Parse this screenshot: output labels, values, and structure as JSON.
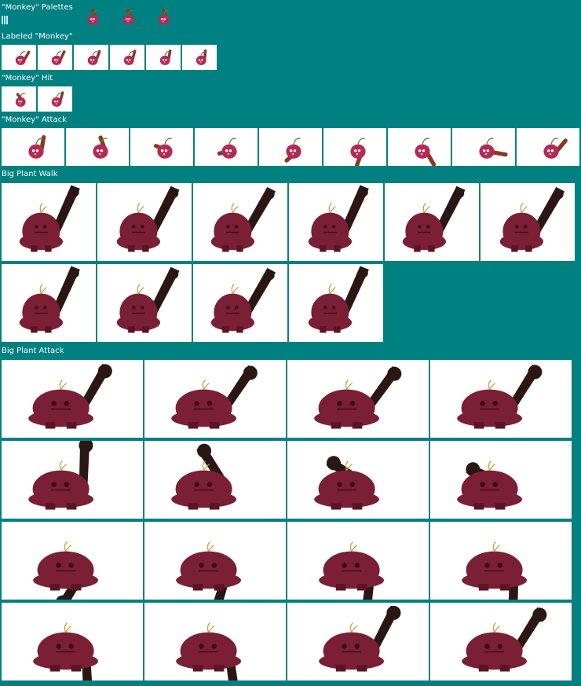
{
  "sections": {
    "palettes": "\"Monkey\" Palettes",
    "labeled": "Labeled \"Monkey\"",
    "hit": "\"Monkey\" Hit",
    "attack": "\"Monkey\" Attack",
    "walk": "Big Plant Walk",
    "big_attack": "Big Plant Attack"
  },
  "colors": {
    "background": "#008080",
    "frame": "#ffffff",
    "monkey_body": "#b52a55",
    "monkey_club": "#8b3a22",
    "big_plant_body": "#7a1f35",
    "big_plant_club": "#2a1612",
    "sprout": "#c8a238"
  },
  "counts": {
    "palettes": 3,
    "labeled": 6,
    "hit": 2,
    "attack": 9,
    "walk": 10,
    "big_attack": 16
  }
}
